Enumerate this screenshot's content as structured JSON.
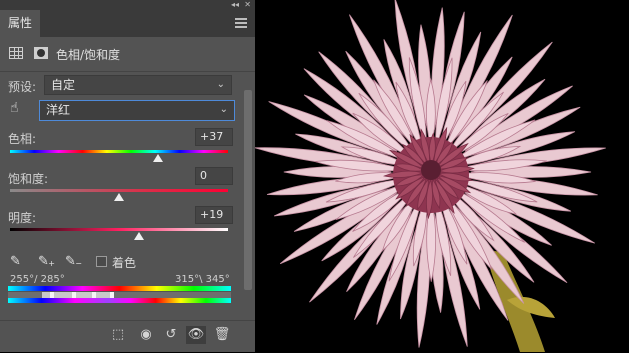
{
  "panel": {
    "tab_label": "属性",
    "collapse_glyph": "◂◂",
    "close_glyph": "✕",
    "title": "色相/饱和度"
  },
  "preset": {
    "label": "预设:",
    "value": "自定"
  },
  "channel": {
    "value": "洋红"
  },
  "hue": {
    "label": "色相:",
    "value": "+37",
    "level": 0.68
  },
  "saturation": {
    "label": "饱和度:",
    "value": "0",
    "level": 0.5
  },
  "lightness": {
    "label": "明度:",
    "value": "+19",
    "level": 0.59
  },
  "colorize": {
    "label": "着色",
    "checked": false
  },
  "range": {
    "left_text": "255°/ 285°",
    "right_text": "315°\\ 345°"
  },
  "icons": {
    "target": "hand-target-icon",
    "eyedropper": "eyedropper-icon",
    "eyedropper_add": "eyedropper-plus-icon",
    "eyedropper_subtract": "eyedropper-minus-icon",
    "clip": "clip-to-layer-icon",
    "view_previous": "view-previous-icon",
    "reset": "reset-icon",
    "visibility": "eye-icon",
    "delete": "trash-icon"
  },
  "colors": {
    "panel_bg": "#535353",
    "accent": "#4e8ad9",
    "photo_bg": "#000000",
    "petal": "#e9c9d1",
    "petal_dark": "#a64a63",
    "stem": "#c8b23a"
  }
}
